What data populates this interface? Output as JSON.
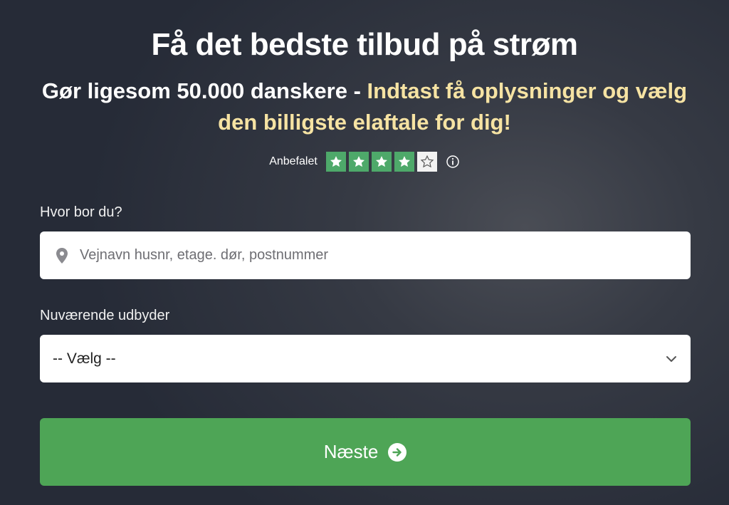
{
  "header": {
    "title": "Få det bedste tilbud på strøm",
    "subtitle_white": "Gør ligesom 50.000 danskere - ",
    "subtitle_highlight": "Indtast få oplysninger og vælg den billigste elaftale for dig!"
  },
  "rating": {
    "label": "Anbefalet",
    "stars": 4,
    "max_stars": 5,
    "filled_color": "#4ea96a",
    "info_icon": "info-icon"
  },
  "address": {
    "label": "Hvor bor du?",
    "placeholder": "Vejnavn husnr, etage. dør, postnummer",
    "icon": "location-pin-icon"
  },
  "provider": {
    "label": "Nuværende udbyder",
    "selected": "-- Vælg --",
    "icon": "chevron-down-icon"
  },
  "next_button": {
    "label": "Næste",
    "icon": "arrow-right-circle-icon",
    "color": "#4ea556"
  },
  "colors": {
    "highlight_text": "#f6e3a3",
    "background": "#2b303b"
  }
}
